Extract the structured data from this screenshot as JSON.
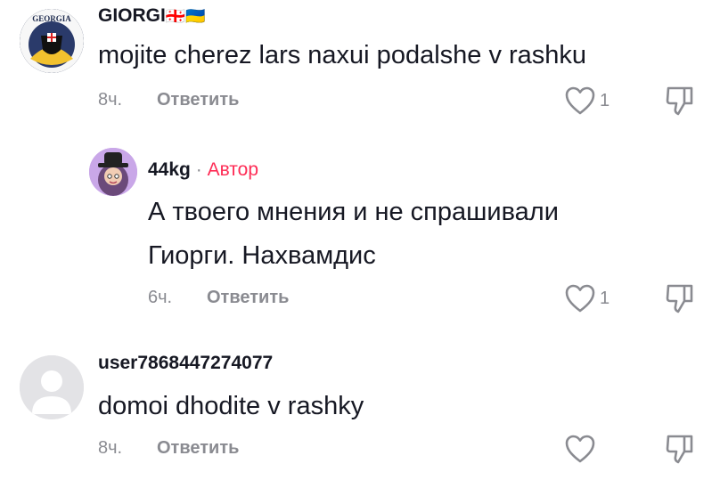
{
  "comments": [
    {
      "username": "GIORGI",
      "flags": "🇬🇪🇺🇦",
      "avatar_text": "GEORGIA",
      "text": "mojite cherez lars naxui podalshe v rashku",
      "time": "8ч.",
      "reply_label": "Ответить",
      "likes": "1"
    },
    {
      "username": "44kg",
      "separator": "·",
      "badge": "Автор",
      "text_lines": [
        "А твоего мнения и не спрашивали",
        "Гиорги. Нахвамдис"
      ],
      "time": "6ч.",
      "reply_label": "Ответить",
      "likes": "1"
    },
    {
      "username": "user7868447274077",
      "text": "domoi dhodite v rashky",
      "time": "8ч.",
      "reply_label": "Ответить",
      "likes": ""
    }
  ],
  "colors": {
    "author_badge": "#fe2c55",
    "muted": "#8a8b91",
    "text": "#161823"
  },
  "icons": {
    "like": "heart-outline-icon",
    "dislike": "thumbs-down-outline-icon"
  }
}
